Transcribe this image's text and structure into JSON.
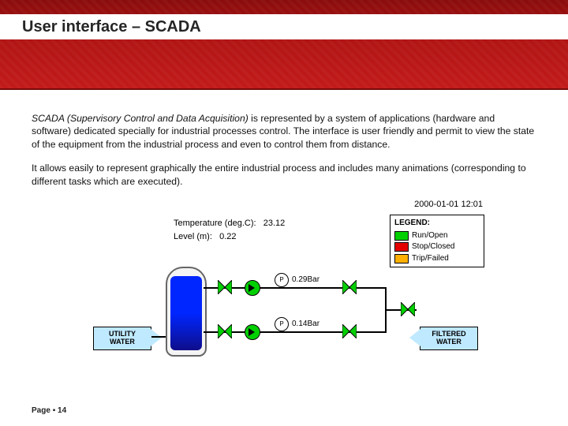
{
  "header": {
    "title": "User interface – SCADA"
  },
  "paragraphs": {
    "p1_ital": "SCADA (Supervisory Control and Data Acquisition)",
    "p1_rest": " is represented by a system of applications (hardware and software) dedicated specially for industrial processes control. The interface is user friendly and permit to view the state of the equipment from the industrial process and even to control them from distance.",
    "p2": "It allows easily to represent graphically the entire industrial process and includes many animations (corresponding to different tasks which are executed)."
  },
  "diagram": {
    "timestamp": "2000-01-01 12:01",
    "temperature_label": "Temperature (deg.C):",
    "temperature_value": "23.12",
    "level_label": "Level (m):",
    "level_value": "0.22",
    "pressure_top": "0.29Bar",
    "pressure_bottom": "0.14Bar",
    "inlet_label": "UTILITY WATER",
    "outlet_label": "FILTERED WATER",
    "gauge_symbol": "P",
    "legend": {
      "title": "LEGEND:",
      "items": [
        {
          "color": "green",
          "label": "Run/Open"
        },
        {
          "color": "red",
          "label": "Stop/Closed"
        },
        {
          "color": "amber",
          "label": "Trip/Failed"
        }
      ]
    }
  },
  "footer": {
    "page_prefix": "Page",
    "page_sep": "▪",
    "page_number": "14"
  }
}
